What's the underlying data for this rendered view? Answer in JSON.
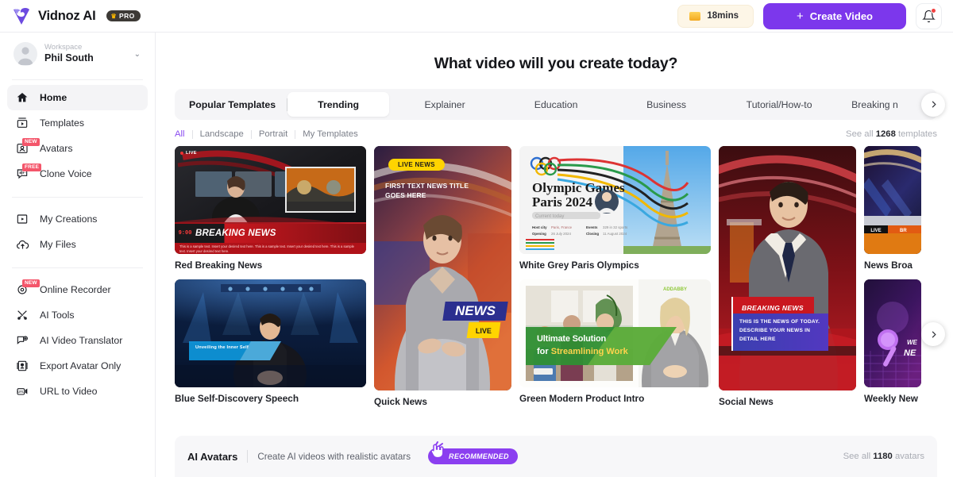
{
  "topbar": {
    "brand_name": "Vidnoz AI",
    "pro_badge": "PRO",
    "minutes": "18mins",
    "create_label": "Create Video",
    "create_color": "#7c37ec"
  },
  "sidebar": {
    "workspace_label": "Workspace",
    "workspace_name": "Phil South",
    "groups": [
      {
        "items": [
          {
            "label": "Home",
            "icon": "home-icon",
            "active": true,
            "badge": ""
          },
          {
            "label": "Templates",
            "icon": "templates-icon",
            "active": false,
            "badge": ""
          },
          {
            "label": "Avatars",
            "icon": "avatars-icon",
            "active": false,
            "badge": "NEW"
          },
          {
            "label": "Clone Voice",
            "icon": "clone-voice-icon",
            "active": false,
            "badge": "FREE"
          }
        ]
      },
      {
        "items": [
          {
            "label": "My Creations",
            "icon": "my-creations-icon",
            "active": false,
            "badge": ""
          },
          {
            "label": "My Files",
            "icon": "my-files-icon",
            "active": false,
            "badge": ""
          }
        ]
      },
      {
        "items": [
          {
            "label": "Online Recorder",
            "icon": "online-recorder-icon",
            "active": false,
            "badge": "NEW"
          },
          {
            "label": "AI Tools",
            "icon": "ai-tools-icon",
            "active": false,
            "badge": ""
          },
          {
            "label": "AI Video Translator",
            "icon": "ai-video-translator-icon",
            "active": false,
            "badge": ""
          },
          {
            "label": "Export Avatar Only",
            "icon": "export-avatar-icon",
            "active": false,
            "badge": ""
          },
          {
            "label": "URL to Video",
            "icon": "url-to-video-icon",
            "active": false,
            "badge": ""
          }
        ]
      }
    ]
  },
  "main": {
    "page_title": "What video will you create today?",
    "tabs": [
      {
        "label": "Popular Templates",
        "state": "lead"
      },
      {
        "label": "Trending",
        "state": "selected"
      },
      {
        "label": "Explainer",
        "state": "normal"
      },
      {
        "label": "Education",
        "state": "normal"
      },
      {
        "label": "Business",
        "state": "normal"
      },
      {
        "label": "Tutorial/How-to",
        "state": "normal"
      },
      {
        "label": "Breaking n",
        "state": "normal"
      }
    ],
    "filters": [
      {
        "label": "All",
        "active": true
      },
      {
        "label": "Landscape",
        "active": false
      },
      {
        "label": "Portrait",
        "active": false
      },
      {
        "label": "My Templates",
        "active": false
      }
    ],
    "see_all_prefix": "See all",
    "see_all_count": "1268",
    "see_all_suffix": "templates",
    "templates": [
      {
        "title": "Red Breaking News",
        "overlay_title": "BREAKING NEWS",
        "overlay_time": "9:00",
        "overlay_tag": "LIVE",
        "overlay_body": "This is a sample text. Insert your desired text here. This is a sample text. Insert your desired text here. This is a sample text. Insert your desired text here."
      },
      {
        "title": "Blue Self-Discovery Speech",
        "overlay_title": "Unveiling the Inner Self"
      },
      {
        "title": "Quick News",
        "overlay_tag": "LIVE NEWS",
        "overlay_title": "FIRST TEXT NEWS TITLE GOES HERE",
        "overlay_news": "NEWS",
        "overlay_live": "LIVE"
      },
      {
        "title": "White Grey Paris Olympics",
        "overlay_title": "Olympic Games",
        "overlay_sub": "Paris 2024",
        "overlay_caption": "Current today"
      },
      {
        "title": "Green Modern Product Intro",
        "overlay_title": "Ultimate Solution",
        "overlay_title2": "for",
        "overlay_title3": "Streamlining Work"
      },
      {
        "title": "Social News",
        "overlay_tag": "BREAKING NEWS",
        "overlay_body": "THIS IS THE  NEWS OF TODAY. DESCRIBE YOUR NEWS IN DETAIL HERE"
      },
      {
        "title": "News Broa",
        "overlay_tag": "LIVE",
        "overlay_tag2": "BR"
      },
      {
        "title": "Weekly New",
        "overlay_title": "WE NE"
      }
    ]
  },
  "avatars_band": {
    "title": "AI Avatars",
    "subtitle": "Create AI videos with realistic avatars",
    "recommended": "RECOMMENDED",
    "see_all_prefix": "See all",
    "see_all_count": "1180",
    "see_all_suffix": "avatars"
  }
}
